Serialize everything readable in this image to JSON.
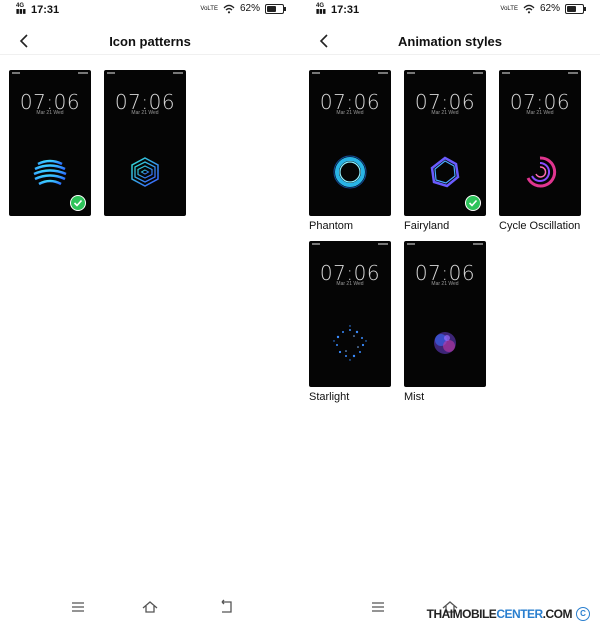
{
  "status_bar": {
    "network_top": "4G",
    "time": "17:31",
    "volte": "VoLTE",
    "battery_percent": "62%",
    "battery_level": 0.62
  },
  "left_panel": {
    "title": "Icon patterns",
    "lock_preview": {
      "time": "07:06",
      "date": "Mar 21  Wed"
    },
    "patterns": [
      {
        "icon": "striped-sphere-icon",
        "selected": true
      },
      {
        "icon": "cube-lines-icon",
        "selected": false
      }
    ]
  },
  "right_panel": {
    "title": "Animation styles",
    "lock_preview": {
      "time": "07:06",
      "date": "Mar 21  Wed"
    },
    "styles": [
      {
        "label": "Phantom",
        "icon": "phantom-ring-icon",
        "selected": false
      },
      {
        "label": "Fairyland",
        "icon": "fairyland-ring-icon",
        "selected": true
      },
      {
        "label": "Cycle Oscillation",
        "icon": "cycle-oscillation-icon",
        "selected": false
      },
      {
        "label": "Starlight",
        "icon": "starlight-icon",
        "selected": false
      },
      {
        "label": "Mist",
        "icon": "mist-icon",
        "selected": false
      }
    ]
  },
  "nav_bar": {
    "icons": [
      "menu-icon",
      "home-icon",
      "back-icon"
    ]
  },
  "watermark": {
    "text_a": "THAIMOBILE",
    "text_b": "CENTER",
    "text_c": ".COM",
    "symbol": "C"
  }
}
